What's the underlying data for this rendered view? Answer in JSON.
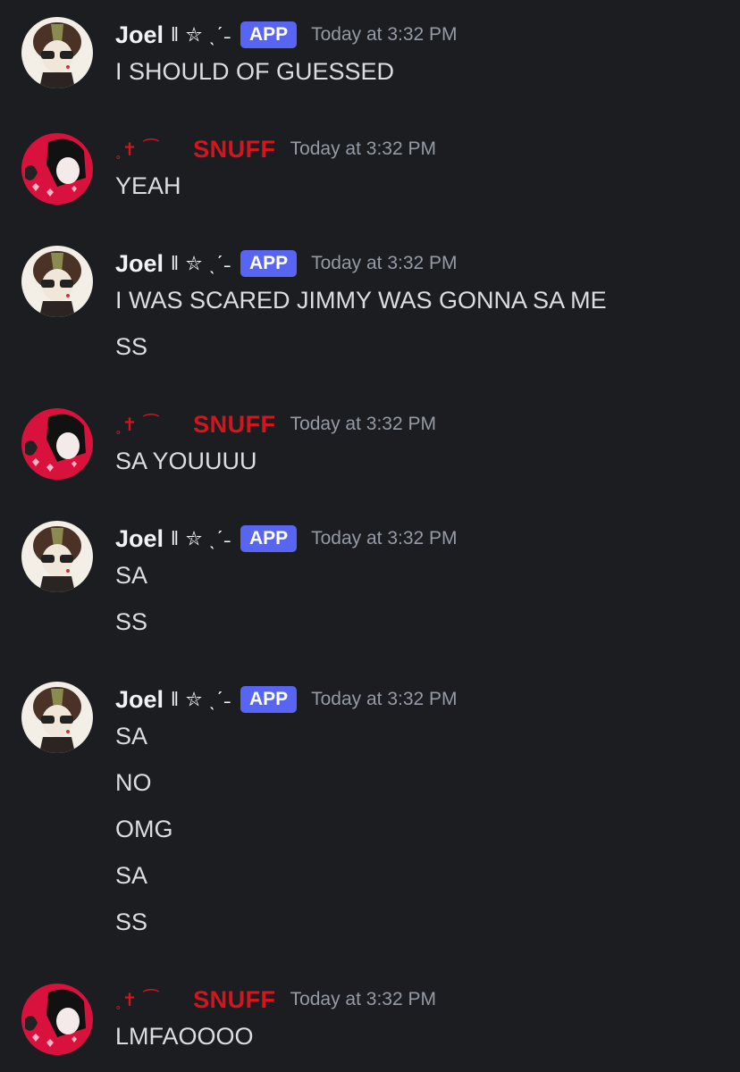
{
  "users": {
    "joel": {
      "name": "Joel",
      "decoration": "‖ ⛥ ˎˊ˗",
      "badge": "APP"
    },
    "snuff": {
      "name": "SNUFF",
      "decoration": "˳✝︎ ⁀"
    }
  },
  "timestamp": "Today at 3:32 PM",
  "messages": [
    {
      "author": "joel",
      "lines": [
        "I SHOULD OF GUESSED"
      ]
    },
    {
      "author": "snuff",
      "lines": [
        "YEAH"
      ]
    },
    {
      "author": "joel",
      "lines": [
        "I WAS SCARED JIMMY WAS GONNA SA ME",
        "SS"
      ]
    },
    {
      "author": "snuff",
      "lines": [
        "SA YOUUUU"
      ]
    },
    {
      "author": "joel",
      "lines": [
        "SA",
        "SS"
      ]
    },
    {
      "author": "joel",
      "lines": [
        "SA",
        "NO",
        "OMG",
        "SA",
        "SS"
      ]
    },
    {
      "author": "snuff",
      "lines": [
        "LMFAOOOO"
      ]
    }
  ],
  "colors": {
    "background": "#1c1d21",
    "snuff_name": "#d6141d",
    "app_badge": "#5865f2",
    "timestamp": "#949ba4",
    "message_text": "#dbdee1"
  }
}
